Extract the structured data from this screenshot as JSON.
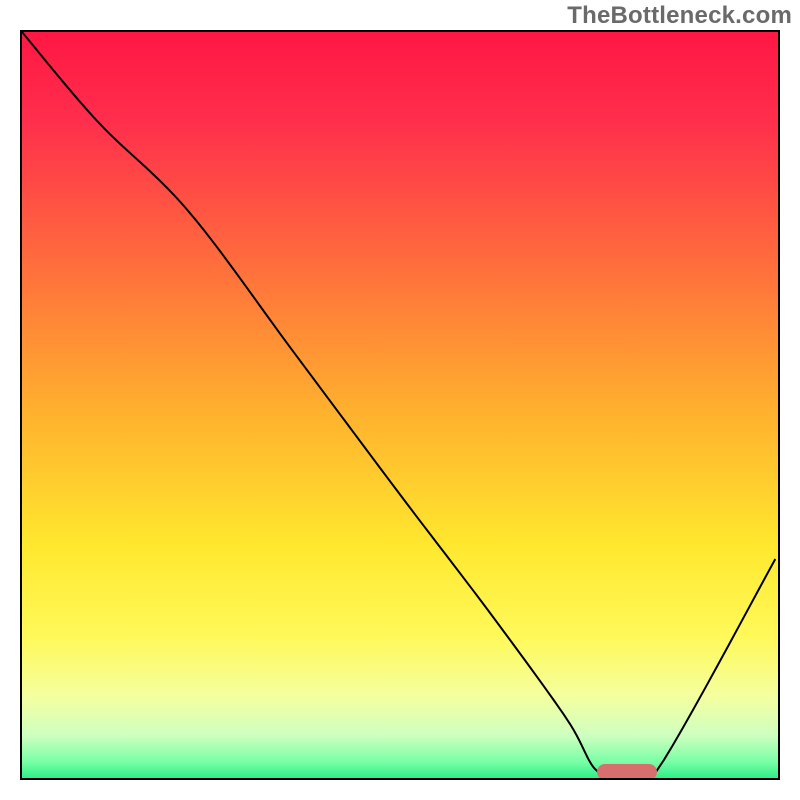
{
  "watermark": "TheBottleneck.com",
  "chart_data": {
    "type": "line",
    "title": "",
    "xlabel": "",
    "ylabel": "",
    "xlim": [
      0,
      100
    ],
    "ylim": [
      0,
      100
    ],
    "grid": false,
    "legend": false,
    "background_gradient": {
      "stops": [
        {
          "offset": 0.0,
          "color": "#ff1744"
        },
        {
          "offset": 0.12,
          "color": "#ff2f4c"
        },
        {
          "offset": 0.3,
          "color": "#ff6b3d"
        },
        {
          "offset": 0.5,
          "color": "#ffb02e"
        },
        {
          "offset": 0.68,
          "color": "#ffe82e"
        },
        {
          "offset": 0.8,
          "color": "#fff95a"
        },
        {
          "offset": 0.88,
          "color": "#f4ffa0"
        },
        {
          "offset": 0.93,
          "color": "#cfffc0"
        },
        {
          "offset": 0.965,
          "color": "#7affa6"
        },
        {
          "offset": 1.0,
          "color": "#00e676"
        }
      ]
    },
    "series": [
      {
        "name": "bottleneck-curve",
        "color": "#000000",
        "x": [
          0,
          10,
          22,
          36,
          50,
          62,
          72,
          76,
          80,
          84,
          100
        ],
        "y": [
          100,
          88,
          76,
          57,
          38,
          22,
          8,
          1,
          0.5,
          1,
          30
        ]
      }
    ],
    "highlight_segment": {
      "name": "optimal-range",
      "color": "#d86f6f",
      "x_start": 76,
      "x_end": 84,
      "y": 0.8,
      "thickness": 2.2
    }
  }
}
